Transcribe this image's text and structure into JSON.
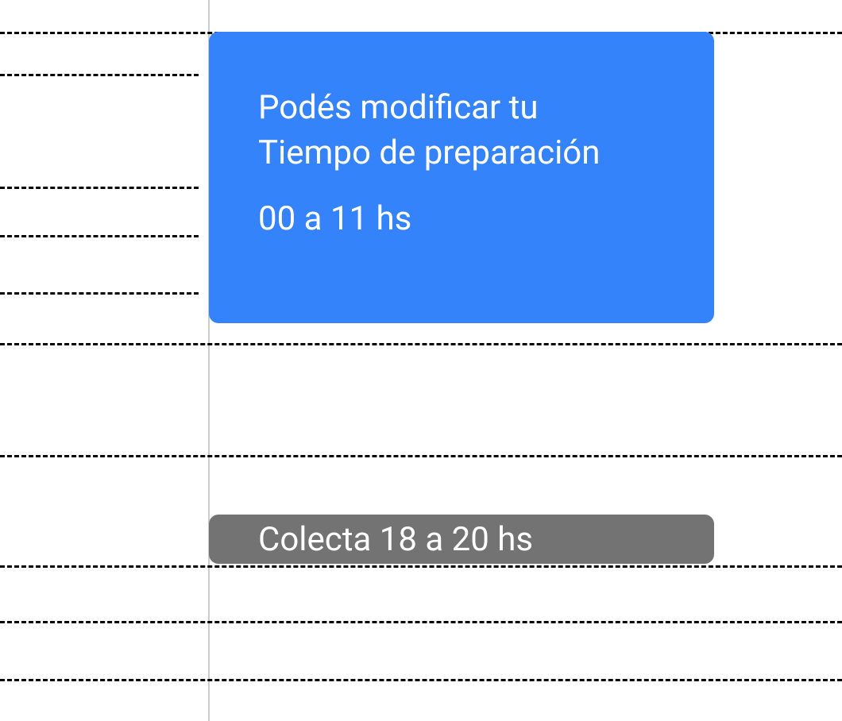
{
  "prepTime": {
    "titleLine1": "Podés modificar tu",
    "titleLine2": "Tiempo de preparación",
    "timeRange": "00 a 11 hs"
  },
  "collection": {
    "label": "Colecta 18 a 20 hs"
  },
  "timeline": {
    "fullLines": [
      40,
      432,
      573,
      712,
      782,
      855
    ],
    "partialLines": [
      93,
      235,
      296,
      368
    ]
  },
  "colors": {
    "accent": "#3483fa",
    "secondary": "#737373"
  }
}
